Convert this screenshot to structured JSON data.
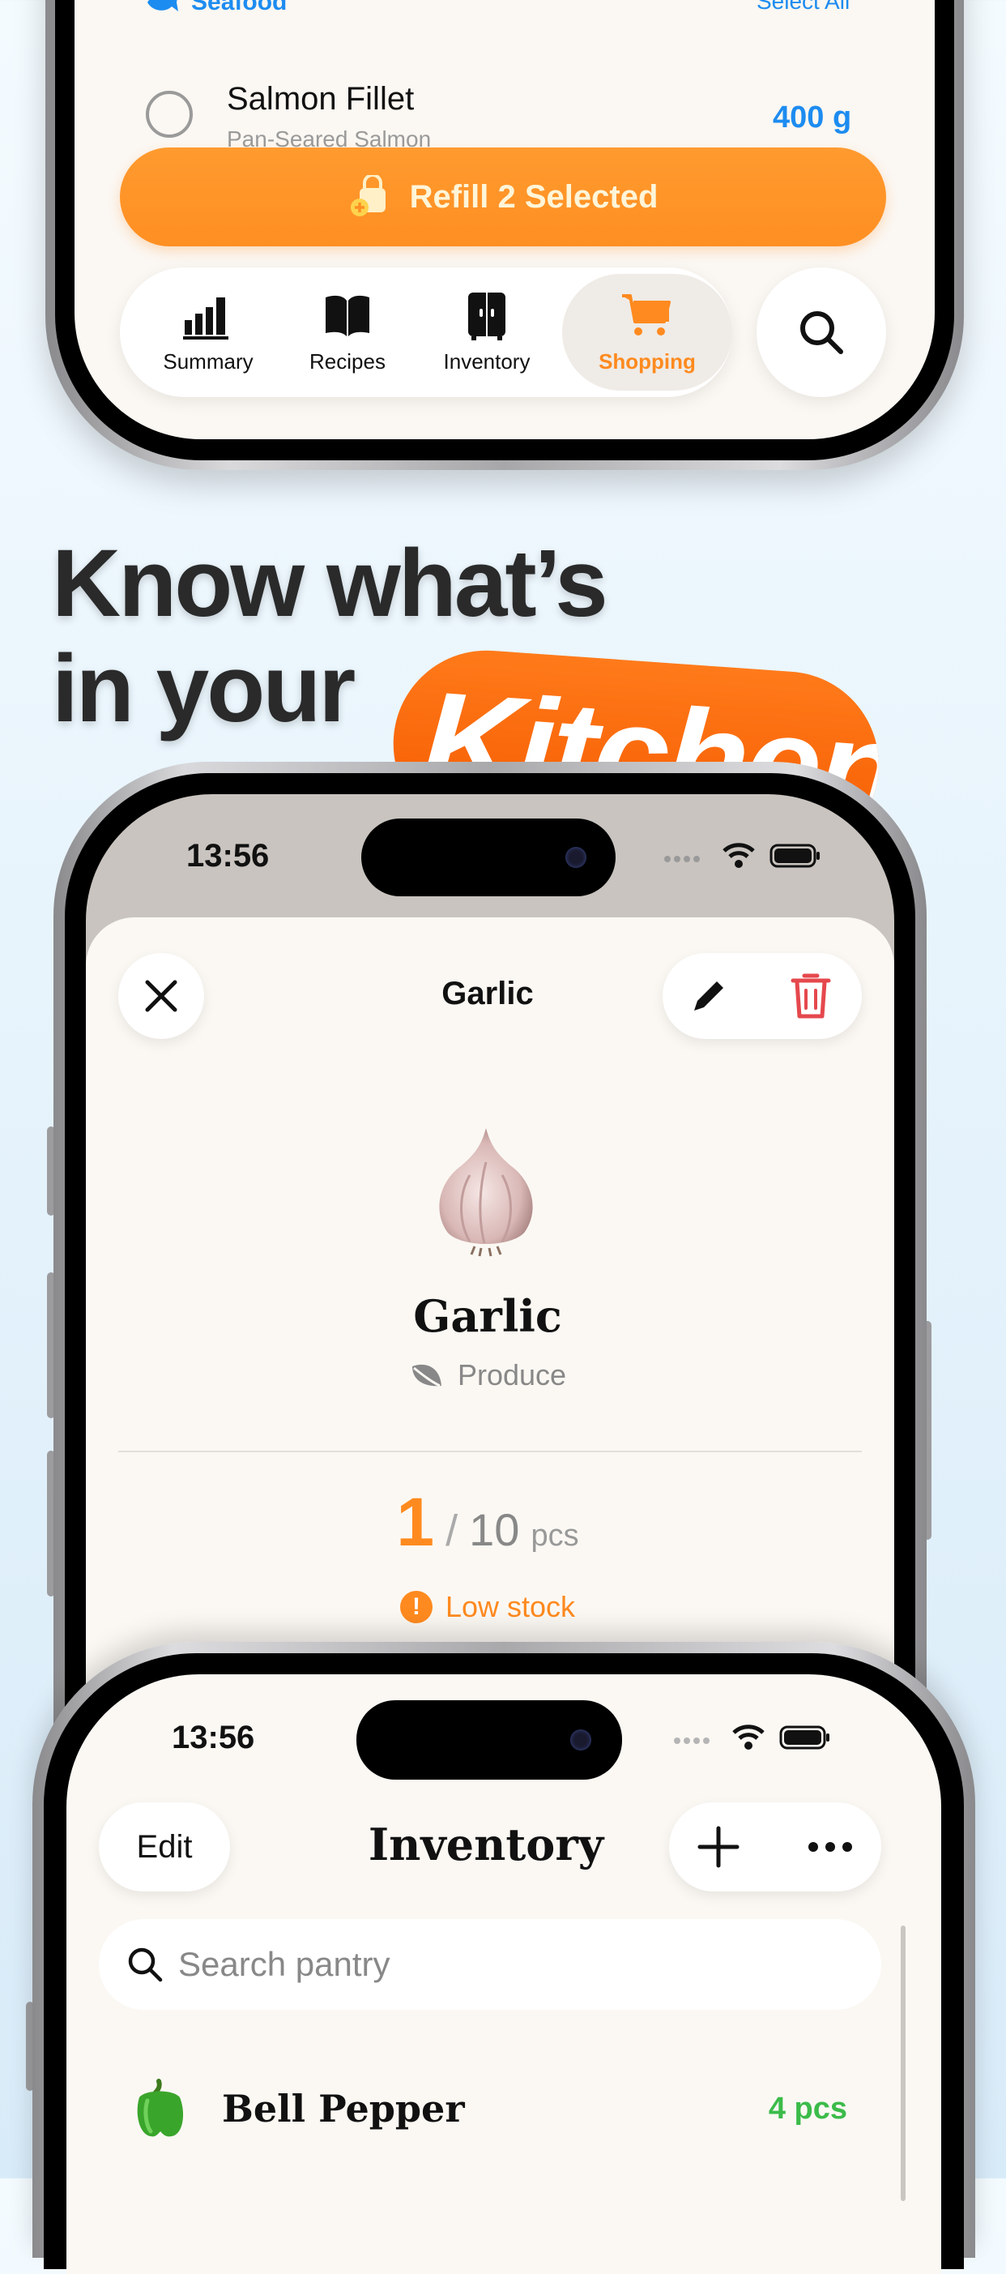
{
  "top_phone": {
    "section_label": "Seafood",
    "select_all": "Select All",
    "item": {
      "name": "Salmon Fillet",
      "subtitle": "Pan-Seared Salmon",
      "quantity": "400 g"
    },
    "refill_button": "Refill 2 Selected",
    "tabs": [
      {
        "label": "Summary",
        "icon": "bar-chart-icon",
        "active": false
      },
      {
        "label": "Recipes",
        "icon": "open-book-icon",
        "active": false
      },
      {
        "label": "Inventory",
        "icon": "cabinet-icon",
        "active": false
      },
      {
        "label": "Shopping",
        "icon": "cart-icon",
        "active": true
      }
    ],
    "search_icon": "search-icon"
  },
  "headline": {
    "line1": "Know what’s",
    "line2": "in your",
    "highlight": "Kitchen"
  },
  "detail_phone": {
    "status_time": "13:56",
    "title": "Garlic",
    "item_name": "Garlic",
    "category": "Produce",
    "quantity_current": "1",
    "quantity_separator": "/",
    "quantity_max": "10",
    "quantity_unit": "pcs",
    "stock_status": "Low stock",
    "colors": {
      "accent": "#ff8a1f",
      "delete": "#e5484d"
    }
  },
  "inventory_phone": {
    "status_time": "13:56",
    "edit_label": "Edit",
    "title": "Inventory",
    "search_placeholder": "Search pantry",
    "items": [
      {
        "name": "Bell Pepper",
        "quantity": "4 pcs",
        "color": "#3bbb4a"
      }
    ]
  }
}
